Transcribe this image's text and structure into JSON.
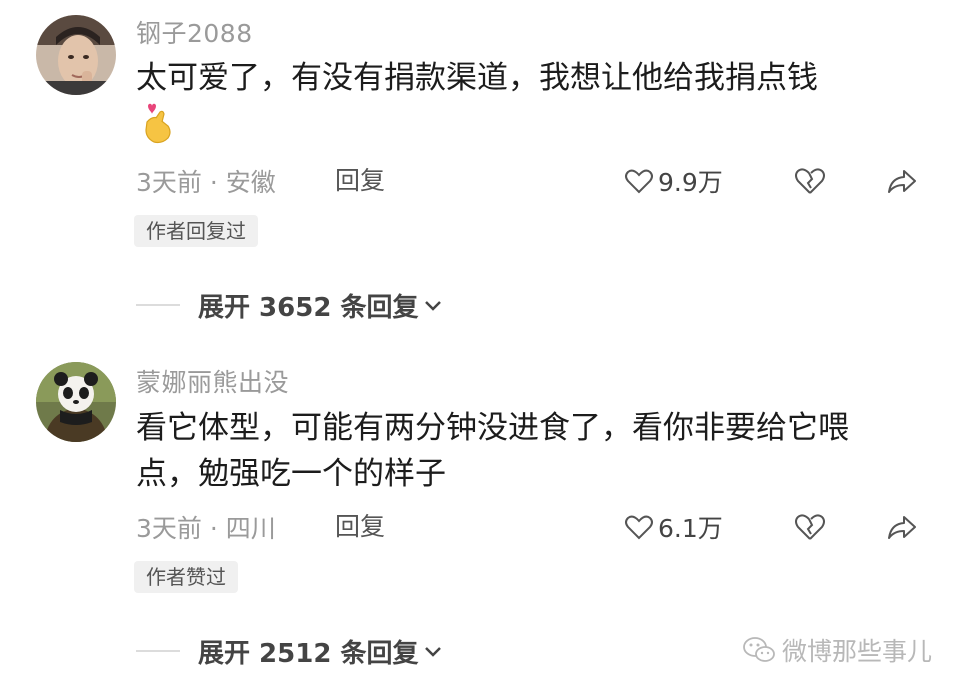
{
  "comments": [
    {
      "username": "钢子2088",
      "text": "太可爱了，有没有捐款渠道，我想让他给我捐点钱",
      "emoji": "finger-heart-emoji",
      "meta": "3天前 · 安徽",
      "reply_label": "回复",
      "like_count": "9.9万",
      "badge": "作者回复过",
      "expand": "展开 3652 条回复"
    },
    {
      "username": "蒙娜丽熊出没",
      "text_line1": "看它体型，可能有两分钟没进食了，看你非要给它喂",
      "text_line2": "点，勉强吃一个的样子",
      "meta": "3天前 · 四川",
      "reply_label": "回复",
      "like_count": "6.1万",
      "badge": "作者赞过",
      "expand": "展开 2512 条回复"
    }
  ],
  "watermark": "微博那些事儿",
  "icons": {
    "like": "heart-outline-icon",
    "dislike": "broken-heart-icon",
    "share": "share-arrow-icon",
    "expand": "chevron-down-icon",
    "watermark": "wechat-icon"
  },
  "colors": {
    "secondary_text": "#9a9a9a",
    "badge_bg": "#f0f0f0",
    "heart_emoji": "#e8457a",
    "hand_emoji": "#f6c443"
  }
}
